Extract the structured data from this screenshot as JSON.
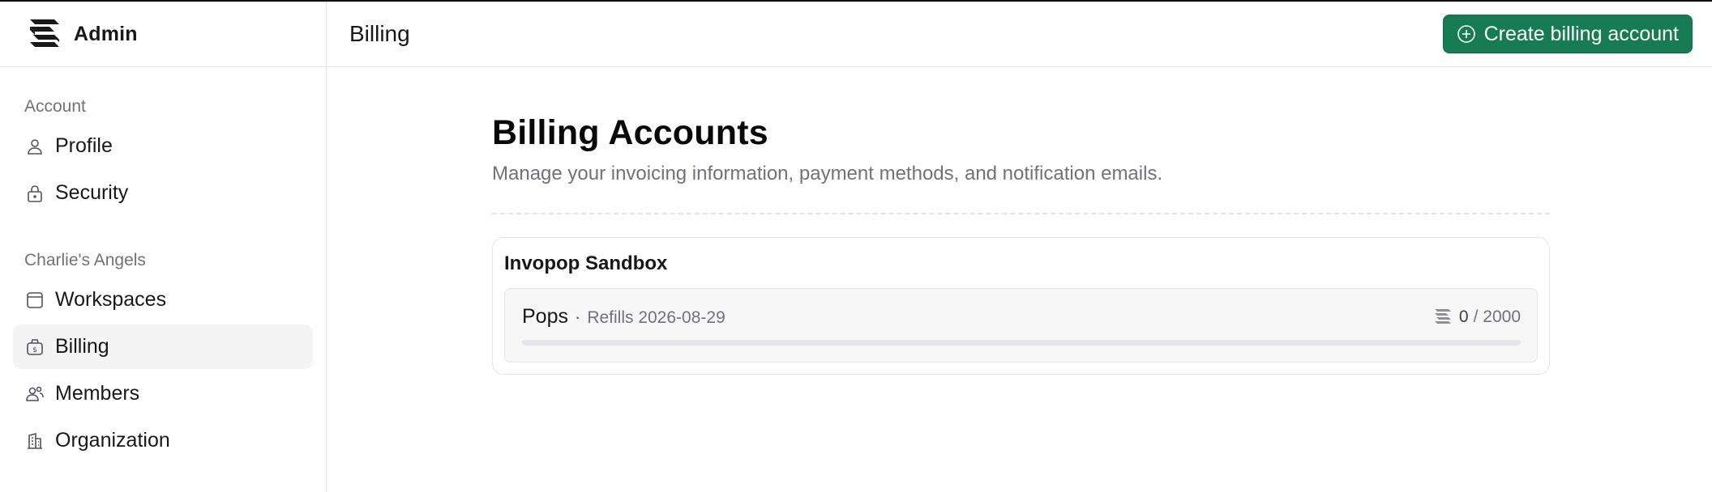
{
  "brand": {
    "name": "Admin",
    "logo_icon": "stacked-layers-logo"
  },
  "header": {
    "title": "Billing",
    "create_button_label": "Create billing account",
    "create_button_color": "#157c53"
  },
  "sidebar": {
    "sections": [
      {
        "label": "Account",
        "items": [
          {
            "label": "Profile",
            "icon": "user-icon",
            "active": false
          },
          {
            "label": "Security",
            "icon": "lock-icon",
            "active": false
          }
        ]
      },
      {
        "label": "Charlie's Angels",
        "items": [
          {
            "label": "Workspaces",
            "icon": "workspace-icon",
            "active": false
          },
          {
            "label": "Billing",
            "icon": "billing-icon",
            "active": true
          },
          {
            "label": "Members",
            "icon": "members-icon",
            "active": false
          },
          {
            "label": "Organization",
            "icon": "building-icon",
            "active": false
          }
        ]
      }
    ]
  },
  "main": {
    "title": "Billing Accounts",
    "description": "Manage your invoicing information, payment methods, and notification emails.",
    "accounts": [
      {
        "name": "Invopop Sandbox",
        "plan": "Pops",
        "separator": "·",
        "refills": "Refills 2026-08-29",
        "used": "0",
        "total": "/ 2000",
        "usage_fraction": 0
      }
    ]
  }
}
